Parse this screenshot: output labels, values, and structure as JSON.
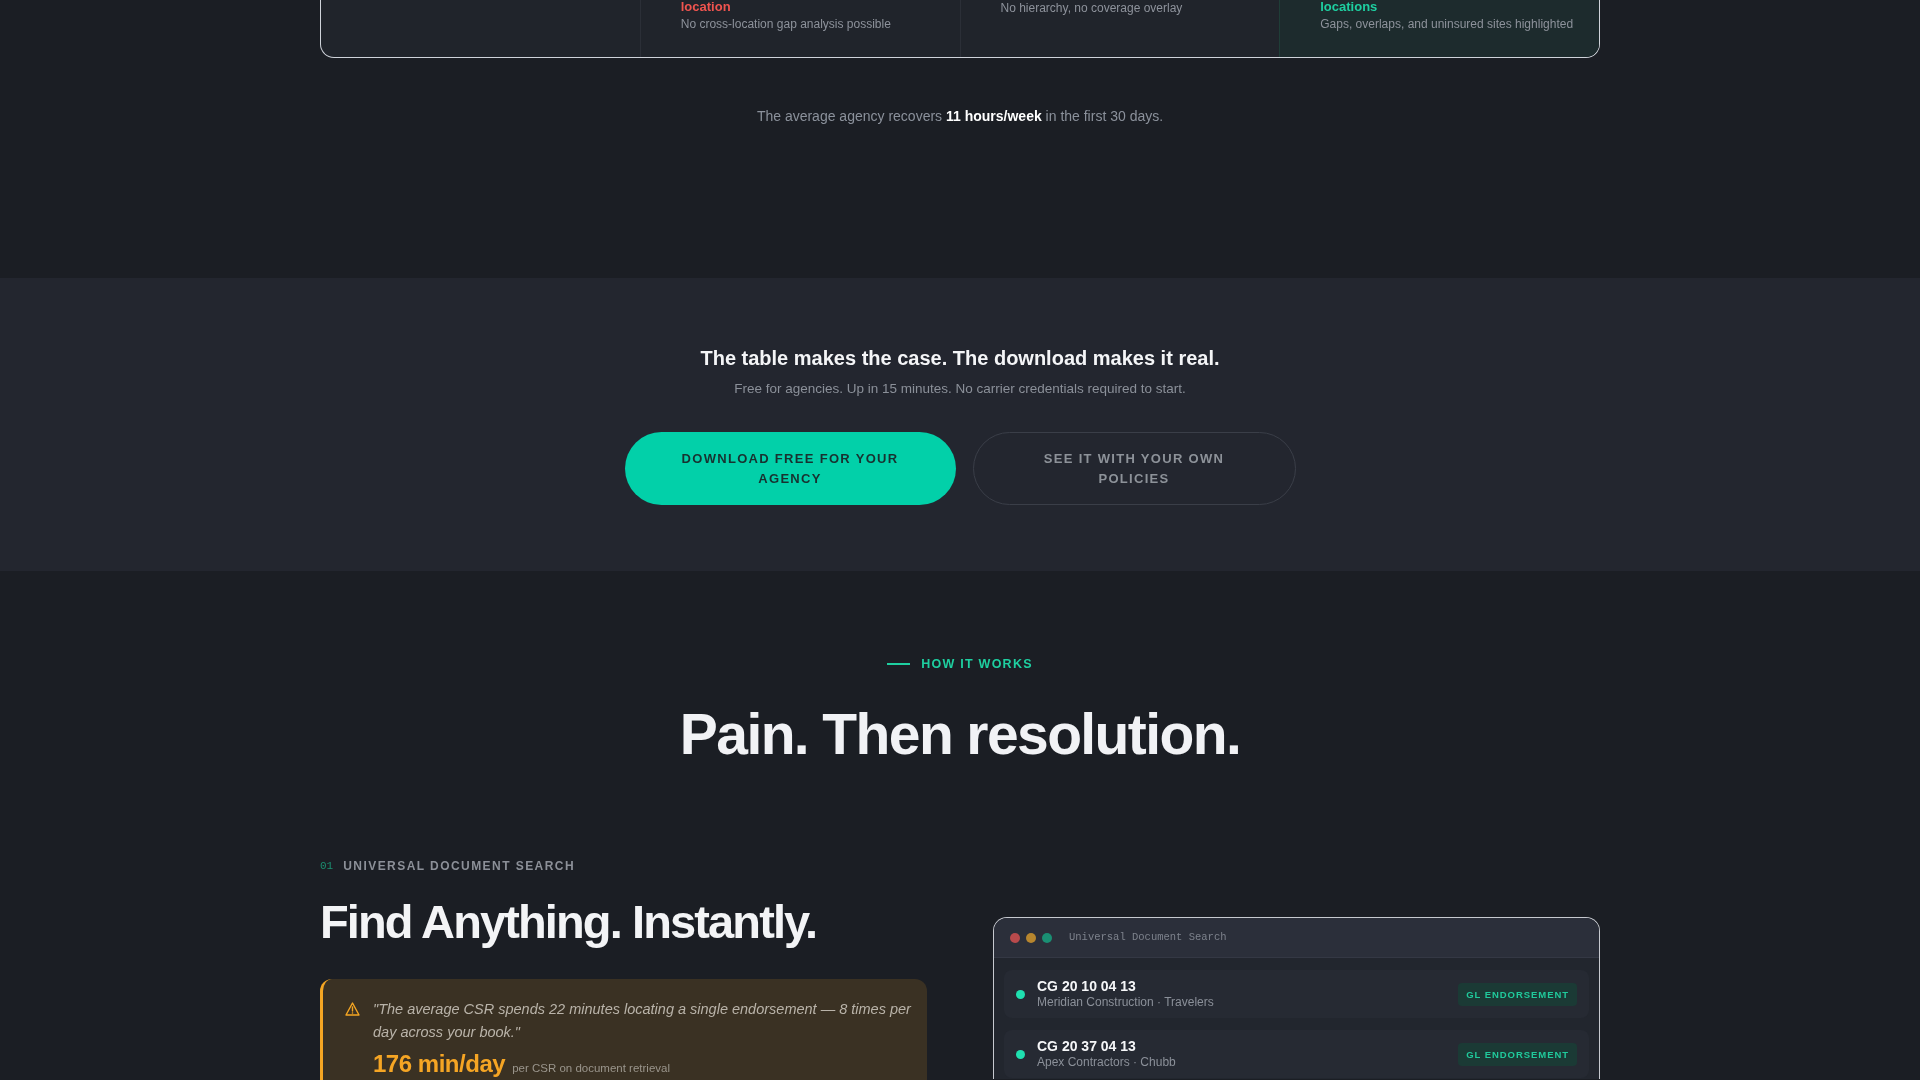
{
  "comparison_table": {
    "cells": [
      {
        "kind": "blank",
        "highlighted": false
      },
      {
        "kind": "negative",
        "highlighted": false,
        "label": "location",
        "note": "No cross-location gap analysis possible"
      },
      {
        "kind": "neutral",
        "highlighted": false,
        "note": "No hierarchy, no coverage overlay"
      },
      {
        "kind": "positive",
        "highlighted": true,
        "label": "locations",
        "note": "Gaps, overlaps, and uninsured sites highlighted"
      }
    ]
  },
  "recovery_note": "The average agency recovers **11 hours/week** in the first 30 days.",
  "cta": {
    "title": "The table makes the case. The download makes it real.",
    "subtitle": "Free for agencies. Up in 15 minutes. No carrier credentials required to start.",
    "buttons": [
      {
        "kind": "primary",
        "label": "DOWNLOAD FREE FOR YOUR AGENCY"
      },
      {
        "kind": "secondary",
        "label": "SEE IT WITH YOUR OWN POLICIES"
      }
    ]
  },
  "how_it_works": {
    "eyebrow": "HOW IT WORKS",
    "title": "Pain. Then resolution."
  },
  "feature": {
    "number": "01",
    "eyebrow": "UNIVERSAL DOCUMENT SEARCH",
    "title": "Find Anything. Instantly.",
    "pain": {
      "quote": "\"The average CSR spends 22 minutes locating a single endorsement — 8 times per day across your book.\"",
      "stat": "176 min/day",
      "stat_note": "per CSR on document retrieval"
    },
    "demo_window": {
      "title": "Universal Document Search",
      "results": [
        {
          "code": "CG 20 10 04 13",
          "detail": "Meridian Construction · Travelers",
          "tag": "GL ENDORSEMENT"
        },
        {
          "code": "CG 20 37 04 13",
          "detail": "Apex Contractors · Chubb",
          "tag": "GL ENDORSEMENT"
        }
      ]
    }
  }
}
